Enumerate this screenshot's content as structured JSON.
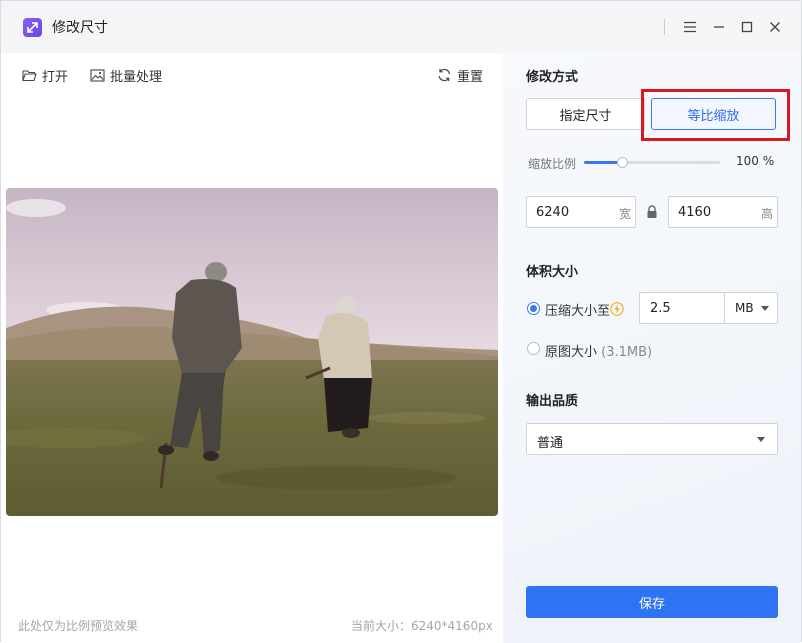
{
  "app": {
    "title": "修改尺寸"
  },
  "toolbar": {
    "open_label": "打开",
    "batch_label": "批量处理",
    "reset_label": "重置"
  },
  "preview": {
    "note": "此处仅为比例预览效果",
    "current_size": "当前大小：6240*4160px"
  },
  "resize": {
    "section_title": "修改方式",
    "modes": [
      {
        "label": "指定尺寸",
        "active": false
      },
      {
        "label": "等比缩放",
        "active": true
      }
    ],
    "scale_label": "缩放比例",
    "scale_value": "100 %",
    "scale_fraction": 0.28,
    "width_value": "6240",
    "width_unit": "宽",
    "height_value": "4160",
    "height_unit": "高"
  },
  "volume": {
    "section_title": "体积大小",
    "compress_label": "压缩大小至",
    "compress_checked": true,
    "size_value": "2.5",
    "size_unit": "MB",
    "original_label": "原图大小",
    "original_size": "(3.1MB)"
  },
  "quality": {
    "section_title": "输出品质",
    "value": "普通"
  },
  "save_label": "保存",
  "colors": {
    "accent": "#2f73f5",
    "highlight": "#d8181e",
    "logo": "#7c4ff0"
  },
  "icons": [
    "resize-logo-icon",
    "folder-open-icon",
    "image-icon",
    "refresh-icon",
    "menu-icon",
    "minimize-icon",
    "maximize-icon",
    "close-icon",
    "lock-icon",
    "lightning-icon",
    "chevron-down-icon"
  ]
}
